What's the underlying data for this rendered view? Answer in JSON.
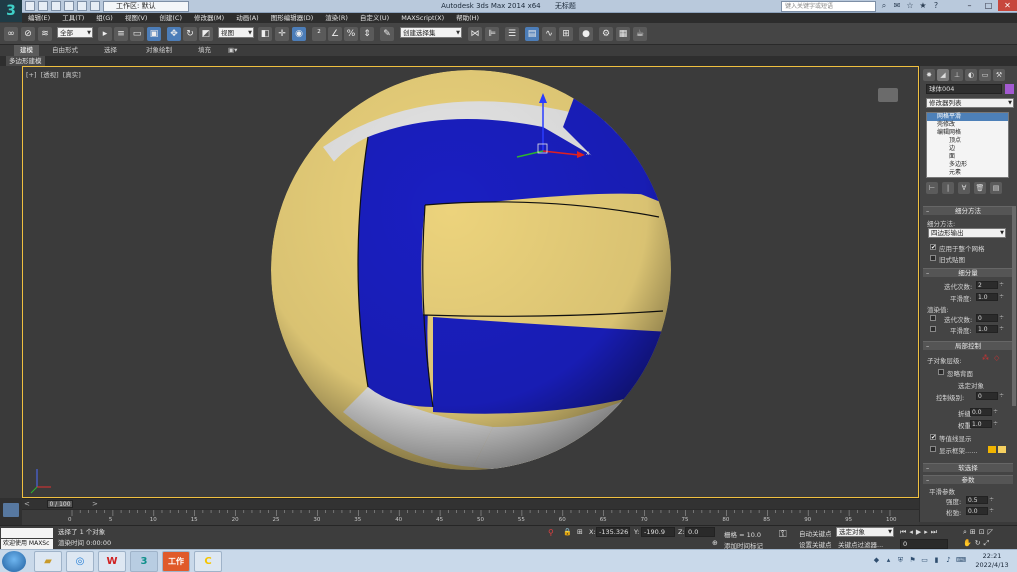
{
  "titlebar": {
    "app_title": "Autodesk 3ds Max  2014 x64",
    "doc_title": "无标题",
    "workspace": "工作区: 默认",
    "search_placeholder": "键入关键字或短语"
  },
  "menu": [
    "编辑(E)",
    "工具(T)",
    "组(G)",
    "视图(V)",
    "创建(C)",
    "修改器(M)",
    "动画(A)",
    "图形编辑器(D)",
    "渲染(R)",
    "自定义(U)",
    "MAXScript(X)",
    "帮助(H)"
  ],
  "toolbar": {
    "selection_filter": "全部",
    "ref_coord": "视图",
    "named_selection": "创建选择集"
  },
  "ribbon": {
    "tabs": [
      "建模",
      "自由形式",
      "选择",
      "对象绘制",
      "填充"
    ],
    "subpanel": "多边形建模"
  },
  "viewport": {
    "label_parts": [
      "[+]",
      "[透视]",
      "[真实]"
    ],
    "gizmo_axes": [
      "x",
      "y",
      "z"
    ]
  },
  "command_panel": {
    "object_name": "球体004",
    "modifier_list": "修改器列表",
    "stack": [
      "网格平滑",
      "壳修改",
      "编辑网格",
      "顶点",
      "边",
      "面",
      "多边形",
      "元素"
    ],
    "subdivision": {
      "header": "细分方法",
      "method_label": "细分方法:",
      "method_value": "四边形输出",
      "apply_whole": "应用于整个网格",
      "old_style": "旧式贴图"
    },
    "subdiv_amount": {
      "header": "细分量",
      "iterations_label": "迭代次数:",
      "iterations_value": "2",
      "smoothness_label": "平滑度:",
      "smoothness_value": "1.0",
      "render_label": "渲染值:",
      "render_iter_label": "迭代次数:",
      "render_iter_value": "0",
      "render_smooth_label": "平滑度:",
      "render_smooth_value": "1.0"
    },
    "local_control": {
      "header": "局部控制",
      "sublevel_label": "子对象层级:",
      "ignore_backface": "忽略背面",
      "selected_label": "选定对象",
      "control_level_label": "控制级别:",
      "control_level_value": "0",
      "crease_label": "折缝:",
      "crease_value": "0.0",
      "weight_label": "权重:",
      "weight_value": "1.0",
      "isoline": "等值线显示",
      "show_cage": "显示框架......"
    },
    "soft_select_header": "软选择",
    "params_header": "参数",
    "smooth_params_label": "平滑参数",
    "strength_label": "强度:",
    "strength_value": "0.5",
    "relax_label": "松弛:",
    "relax_value": "0.0"
  },
  "timeline": {
    "frame_display": "0 / 100",
    "ticks": [
      "0",
      "5",
      "10",
      "15",
      "20",
      "25",
      "30",
      "35",
      "40",
      "45",
      "50",
      "55",
      "60",
      "65",
      "70",
      "75",
      "80",
      "85",
      "90",
      "95",
      "100"
    ]
  },
  "status": {
    "maxscript_label": "欢迎使用 MAXSc",
    "selected": "选择了 1 个对象",
    "render_time": "渲染时间 0:00:00",
    "x_label": "X:",
    "x_value": "-135.326",
    "y_label": "Y:",
    "y_value": "-190.9",
    "z_label": "Z:",
    "z_value": "0.0",
    "grid": "栅格 = 10.0",
    "add_tag": "添加时间标记",
    "auto_key": "自动关键点",
    "set_key": "设置关键点",
    "selection": "选定对象",
    "key_filter": "关键点过滤器...",
    "frame": "0"
  },
  "taskbar": {
    "time": "22:21",
    "date": "2022/4/13",
    "apps": [
      "W",
      "3",
      "工作",
      "C"
    ]
  },
  "colors": {
    "accent": "#4c7db8",
    "viewport_border": "#f0c040",
    "ball_blue": "#1a1fc2",
    "ball_yellow": "#ecd37c",
    "ball_white": "#e6e6e6"
  }
}
